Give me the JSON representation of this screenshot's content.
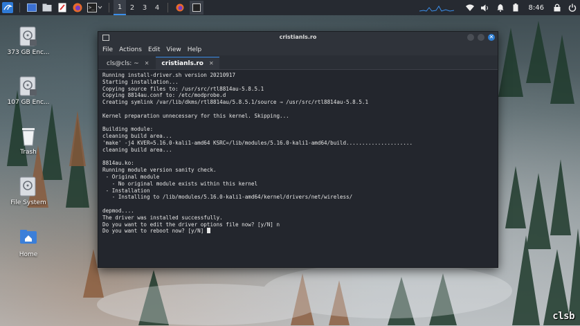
{
  "taskbar": {
    "workspaces": [
      "1",
      "2",
      "3",
      "4"
    ],
    "active_workspace": "1",
    "clock": "8:46"
  },
  "desktop": {
    "icons": [
      {
        "label": "373 GB Enc...",
        "icon": "drive-icon"
      },
      {
        "label": "107 GB Enc...",
        "icon": "drive-icon"
      },
      {
        "label": "Trash",
        "icon": "trash-icon"
      },
      {
        "label": "File System",
        "icon": "filesystem-icon"
      },
      {
        "label": "Home",
        "icon": "home-folder-icon"
      }
    ]
  },
  "window": {
    "title": "cristianls.ro",
    "menu": [
      "File",
      "Actions",
      "Edit",
      "View",
      "Help"
    ],
    "tabs": [
      {
        "label": "cls@cls: ~",
        "active": false
      },
      {
        "label": "cristianls.ro",
        "active": true
      }
    ],
    "terminal_lines": [
      "Running install-driver.sh version 20210917",
      "Starting installation...",
      "Copying source files to: /usr/src/rtl8814au-5.8.5.1",
      "Copying 8814au.conf to: /etc/modprobe.d",
      "Creating symlink /var/lib/dkms/rtl8814au/5.8.5.1/source → /usr/src/rtl8814au-5.8.5.1",
      "",
      "Kernel preparation unnecessary for this kernel. Skipping...",
      "",
      "Building module:",
      "cleaning build area...",
      "'make' -j4 KVER=5.16.0-kali1-amd64 KSRC=/lib/modules/5.16.0-kali1-amd64/build.....................",
      "cleaning build area...",
      "",
      "8814au.ko:",
      "Running module version sanity check.",
      " - Original module",
      "   - No original module exists within this kernel",
      " - Installation",
      "   - Installing to /lib/modules/5.16.0-kali1-amd64/kernel/drivers/net/wireless/",
      "",
      "depmod....",
      "The driver was installed successfully.",
      "Do you want to edit the driver options file now? [y/N] n",
      "Do you want to reboot now? [y/N] "
    ]
  },
  "watermark": "clsb",
  "colors": {
    "accent": "#3b8eea",
    "terminal_bg": "#23262d",
    "taskbar_bg": "#262a31"
  }
}
